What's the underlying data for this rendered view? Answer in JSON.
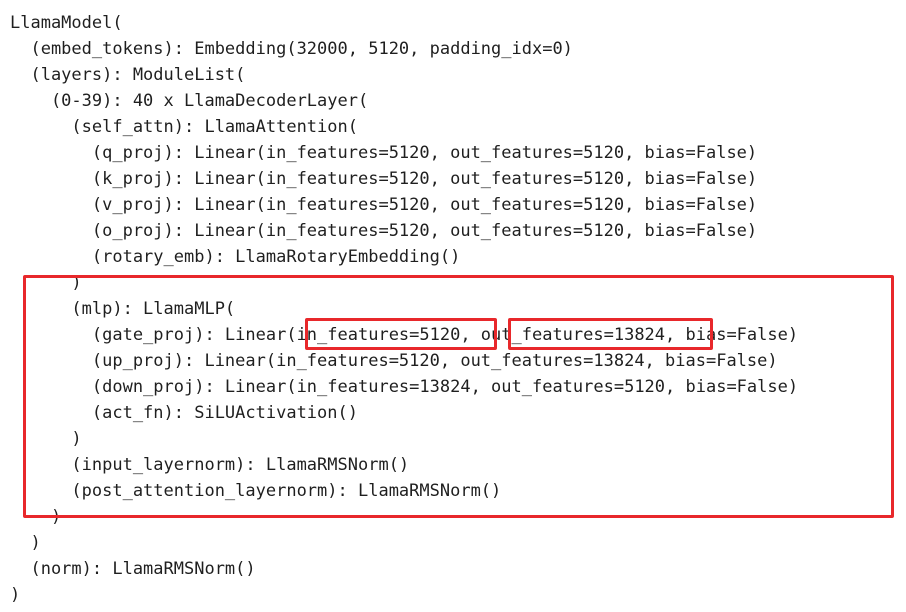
{
  "code_lines": [
    "LlamaModel(",
    "  (embed_tokens): Embedding(32000, 5120, padding_idx=0)",
    "  (layers): ModuleList(",
    "    (0-39): 40 x LlamaDecoderLayer(",
    "      (self_attn): LlamaAttention(",
    "        (q_proj): Linear(in_features=5120, out_features=5120, bias=False)",
    "        (k_proj): Linear(in_features=5120, out_features=5120, bias=False)",
    "        (v_proj): Linear(in_features=5120, out_features=5120, bias=False)",
    "        (o_proj): Linear(in_features=5120, out_features=5120, bias=False)",
    "        (rotary_emb): LlamaRotaryEmbedding()",
    "      )",
    "      (mlp): LlamaMLP(",
    "        (gate_proj): Linear(in_features=5120, out_features=13824, bias=False)",
    "        (up_proj): Linear(in_features=5120, out_features=13824, bias=False)",
    "        (down_proj): Linear(in_features=13824, out_features=5120, bias=False)",
    "        (act_fn): SiLUActivation()",
    "      )",
    "      (input_layernorm): LlamaRMSNorm()",
    "      (post_attention_layernorm): LlamaRMSNorm()",
    "    )",
    "  )",
    "  (norm): LlamaRMSNorm()",
    ")"
  ],
  "annotation_color": "#e8282b"
}
